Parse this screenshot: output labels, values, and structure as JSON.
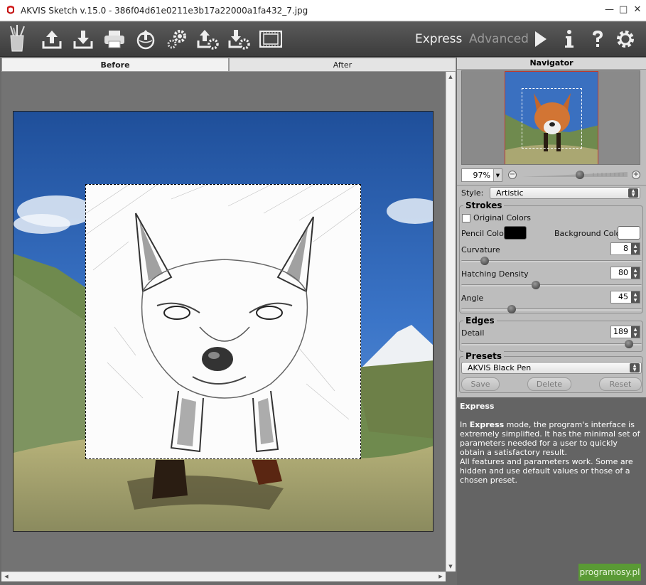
{
  "window": {
    "title": "AKVIS Sketch v.15.0 - 386f04d61e0211e3b17a22000a1fa432_7.jpg",
    "controls": [
      "—",
      "□",
      "✕"
    ]
  },
  "toolbar": {
    "buttons": [
      "brushes-icon",
      "open-icon",
      "save-icon",
      "print-icon",
      "share-icon",
      "batch-icon",
      "import-icon",
      "export-icon",
      "film-icon"
    ],
    "modes": {
      "express": "Express",
      "advanced": "Advanced"
    },
    "right_buttons": [
      "run-icon",
      "info-icon",
      "help-icon",
      "settings-icon"
    ]
  },
  "tabs": {
    "before": "Before",
    "after": "After"
  },
  "navigator": {
    "title": "Navigator",
    "zoom": "97%",
    "zoom_level": 0.55
  },
  "settings": {
    "style_label": "Style:",
    "style_value": "Artistic",
    "strokes": {
      "title": "Strokes",
      "original_colors": "Original Colors",
      "original_colors_checked": false,
      "pencil_color_label": "Pencil Color",
      "pencil_color": "#000000",
      "background_color_label": "Background Color",
      "background_color": "#ffffff",
      "curvature_label": "Curvature",
      "curvature": "8",
      "curvature_level": 0.11,
      "hatching_label": "Hatching Density",
      "hatching": "80",
      "hatching_level": 0.41,
      "angle_label": "Angle",
      "angle": "45",
      "angle_level": 0.27
    },
    "edges": {
      "title": "Edges",
      "detail_label": "Detail",
      "detail": "189",
      "detail_level": 0.95
    },
    "presets": {
      "title": "Presets",
      "value": "AKVIS Black Pen",
      "save": "Save",
      "delete": "Delete",
      "reset": "Reset"
    }
  },
  "help": {
    "title": "Express",
    "p1_a": "In ",
    "p1_b": "Express",
    "p1_c": " mode, the program's interface is extremely simplified. It has the minimal set of parameters needed for a user to quickly obtain a satisfactory result.",
    "p2": "All features and parameters work. Some are hidden and use default values or those of a chosen preset."
  },
  "watermark": "programosy.pl",
  "colors": {
    "accent_green": "#5a9a35",
    "navigator_frame": "#c0392b"
  }
}
